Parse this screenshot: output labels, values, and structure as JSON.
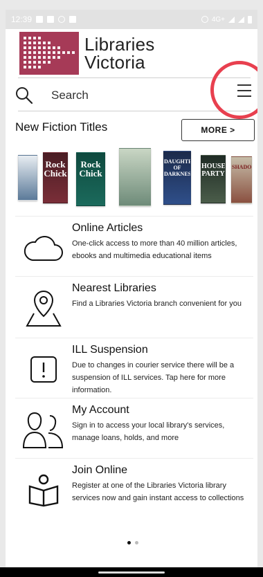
{
  "status_bar": {
    "time": "12:39",
    "network": "4G+"
  },
  "header": {
    "logo_line1": "Libraries",
    "logo_line2": "Victoria",
    "brand_color": "#a63a57",
    "highlight_color": "#e8404f"
  },
  "search": {
    "placeholder": "Search"
  },
  "new_fiction": {
    "title": "New Fiction Titles",
    "more_label": "MORE >",
    "books": [
      {
        "title": "",
        "colors": [
          "#e8edf2",
          "#5b7a99"
        ]
      },
      {
        "title": "Rock Chick",
        "colors": [
          "#4a1d24",
          "#7a2e38"
        ]
      },
      {
        "title": "Rock Chick",
        "colors": [
          "#0f4a3f",
          "#1b6a5c"
        ]
      },
      {
        "title": "",
        "colors": [
          "#c9d6c4",
          "#6e8b79"
        ]
      },
      {
        "title": "DAUGHTER OF DARKNESS",
        "colors": [
          "#1b2a4a",
          "#2f4f8a"
        ]
      },
      {
        "title": "HOUSE PARTY",
        "colors": [
          "#1f2b25",
          "#4b5d4a"
        ]
      },
      {
        "title": "SHADOW",
        "colors": [
          "#c6bda9",
          "#8a5040"
        ]
      }
    ]
  },
  "menu_items": [
    {
      "icon": "cloud-icon",
      "title": "Online Articles",
      "desc": "One-click access to more than 40 million articles, ebooks and multimedia educational items"
    },
    {
      "icon": "map-pin-icon",
      "title": "Nearest Libraries",
      "desc": "Find a Libraries Victoria branch convenient for you"
    },
    {
      "icon": "alert-icon",
      "title": "ILL Suspension",
      "desc": "Due to changes in courier service there will be a suspension of ILL services. Tap here for more information."
    },
    {
      "icon": "users-icon",
      "title": "My Account",
      "desc": "Sign in to access your local library's services, manage loans, holds, and more"
    },
    {
      "icon": "reader-icon",
      "title": "Join Online",
      "desc": "Register at one of the Libraries Victoria library services now and gain instant access to collections"
    }
  ],
  "pager": {
    "active": 0,
    "count": 2
  }
}
